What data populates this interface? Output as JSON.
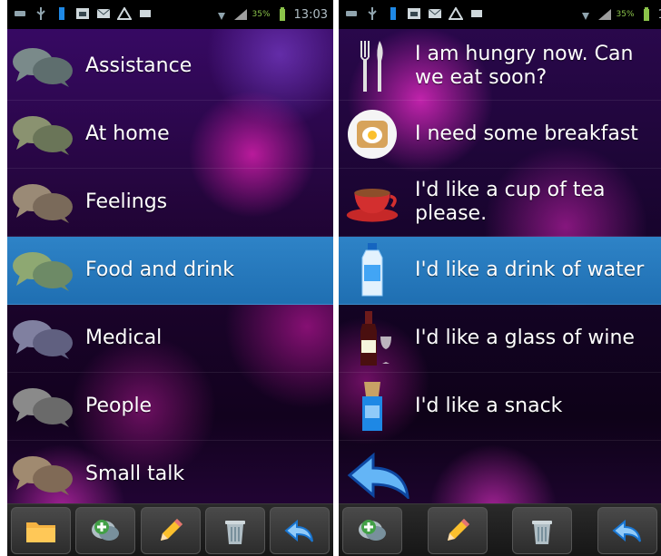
{
  "status_bar": {
    "time": "13:03",
    "battery": "35%"
  },
  "left_screen": {
    "categories": [
      {
        "label": "Assistance",
        "icon": "speech-bubbles-icon",
        "selected": false
      },
      {
        "label": "At home",
        "icon": "speech-bubbles-icon",
        "selected": false
      },
      {
        "label": "Feelings",
        "icon": "speech-bubbles-icon",
        "selected": false
      },
      {
        "label": "Food and drink",
        "icon": "speech-bubbles-icon",
        "selected": true
      },
      {
        "label": "Medical",
        "icon": "speech-bubbles-icon",
        "selected": false
      },
      {
        "label": "People",
        "icon": "speech-bubbles-icon",
        "selected": false
      },
      {
        "label": "Small talk",
        "icon": "speech-bubbles-icon",
        "selected": false
      }
    ],
    "toolbar": [
      "folder-icon",
      "add-phrase-icon",
      "edit-pencil-icon",
      "trash-icon",
      "back-arrow-icon"
    ]
  },
  "right_screen": {
    "phrases": [
      {
        "label": "I am hungry now. Can we eat soon?",
        "icon": "cutlery-icon",
        "selected": false
      },
      {
        "label": "I need some breakfast",
        "icon": "toast-egg-icon",
        "selected": false
      },
      {
        "label": "I'd like a cup of tea please.",
        "icon": "teacup-icon",
        "selected": false
      },
      {
        "label": "I'd like a drink of water",
        "icon": "water-bottle-icon",
        "selected": true
      },
      {
        "label": "I'd like a glass of wine",
        "icon": "wine-bottle-icon",
        "selected": false
      },
      {
        "label": "I'd like a snack",
        "icon": "snack-icon",
        "selected": false
      }
    ],
    "toolbar": [
      "add-phrase-icon",
      "edit-pencil-icon",
      "trash-icon",
      "back-arrow-icon"
    ]
  },
  "colors": {
    "selected_row": "#2e83c7",
    "background": "#1e0430",
    "accent_magenta": "#d21eaa"
  }
}
